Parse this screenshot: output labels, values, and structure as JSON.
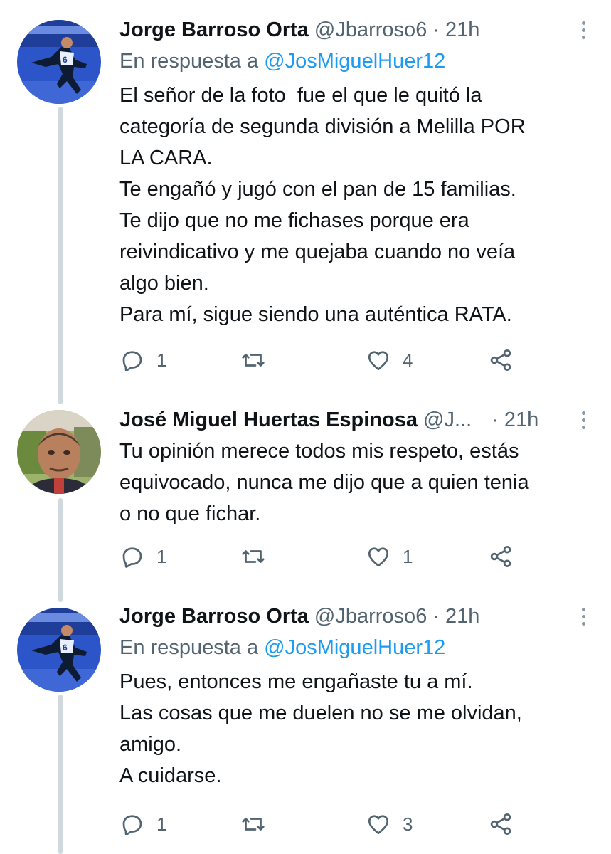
{
  "tweets": [
    {
      "author_name": "Jorge Barroso Orta",
      "handle": "@Jbarroso6",
      "separator": "·",
      "time": "21h",
      "reply_label": "En respuesta a",
      "reply_mention": "@JosMiguelHuer12",
      "text": "El señor de la foto  fue el que le quitó la\ncategoría de segunda división a Melilla POR\nLA CARA.\nTe engañó y jugó con el pan de 15 familias.\nTe dijo que no me fichases porque era\nreivindicativo y me quejaba cuando no veía\nalgo bien.\nPara mí, sigue siendo una auténtica RATA.",
      "replies": "1",
      "retweets": "",
      "likes": "4",
      "avatar_icon": "player-photo-avatar"
    },
    {
      "author_name": "José Miguel Huertas Espinosa",
      "handle": "@J...",
      "separator": "·",
      "time": "21h",
      "text": "Tu opinión merece todos mis respeto, estás\nequivocado, nunca me dijo que a quien tenia\no no que fichar.",
      "replies": "1",
      "retweets": "",
      "likes": "1",
      "avatar_icon": "man-portrait-avatar"
    },
    {
      "author_name": "Jorge Barroso Orta",
      "handle": "@Jbarroso6",
      "separator": "·",
      "time": "21h",
      "reply_label": "En respuesta a",
      "reply_mention": "@JosMiguelHuer12",
      "text": "Pues, entonces me engañaste tu a mí.\nLas cosas que me duelen no se me olvidan,\namigo.\nA cuidarse.",
      "replies": "1",
      "retweets": "",
      "likes": "3",
      "avatar_icon": "player-photo-avatar"
    }
  ],
  "colors": {
    "text": "#0f1419",
    "secondary": "#536471",
    "link": "#1d9bf0",
    "thread_line": "#cfd9de"
  }
}
